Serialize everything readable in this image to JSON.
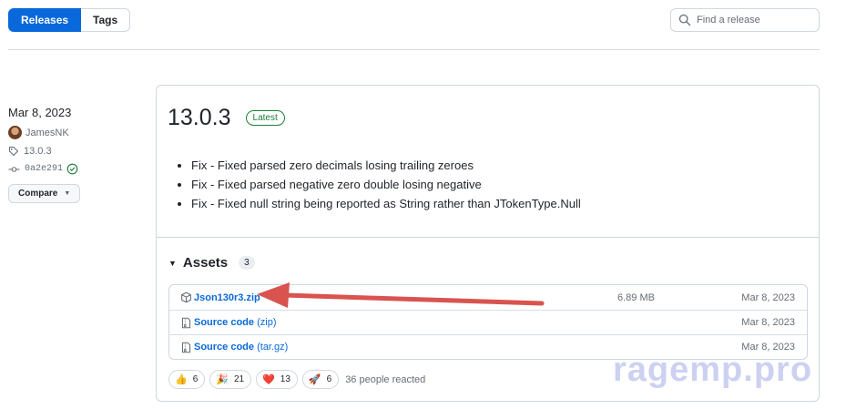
{
  "nav": {
    "releases_label": "Releases",
    "tags_label": "Tags"
  },
  "search": {
    "placeholder": "Find a release",
    "icon": "search-icon"
  },
  "meta": {
    "date": "Mar 8, 2023",
    "author": "JamesNK",
    "tag": "13.0.3",
    "commit": "0a2e291",
    "compare_label": "Compare"
  },
  "release": {
    "title": "13.0.3",
    "badge": "Latest",
    "notes": [
      "Fix - Fixed parsed zero decimals losing trailing zeroes",
      "Fix - Fixed parsed negative zero double losing negative",
      "Fix - Fixed null string being reported as String rather than JTokenType.Null"
    ]
  },
  "assets": {
    "label": "Assets",
    "count": "3",
    "items": [
      {
        "name": "Json130r3.zip",
        "ext": "",
        "size": "6.89 MB",
        "date": "Mar 8, 2023",
        "icon": "package-icon"
      },
      {
        "name": "Source code",
        "ext": "(zip)",
        "size": "",
        "date": "Mar 8, 2023",
        "icon": "file-zip-icon"
      },
      {
        "name": "Source code",
        "ext": "(tar.gz)",
        "size": "",
        "date": "Mar 8, 2023",
        "icon": "file-zip-icon"
      }
    ]
  },
  "reactions": {
    "items": [
      {
        "emoji": "👍",
        "count": "6"
      },
      {
        "emoji": "🎉",
        "count": "21"
      },
      {
        "emoji": "❤️",
        "count": "13"
      },
      {
        "emoji": "🚀",
        "count": "6"
      }
    ],
    "summary": "36 people reacted"
  },
  "watermark": "ragemp.pro",
  "colors": {
    "accent": "#0969da",
    "latest": "#1a7f37",
    "arrow": "#d9534f"
  }
}
